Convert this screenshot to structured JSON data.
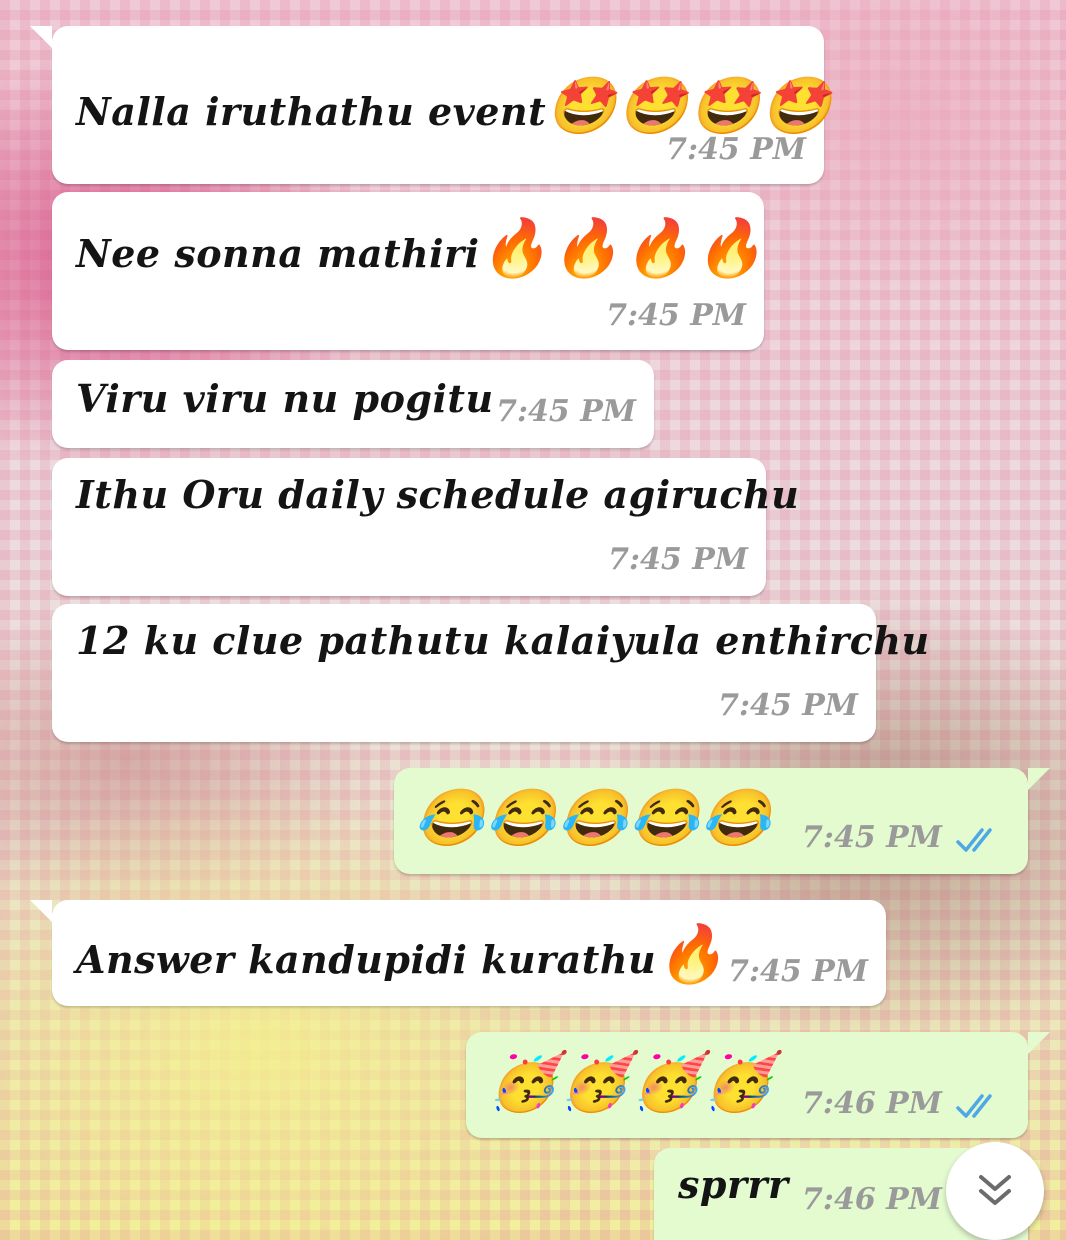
{
  "messages": [
    {
      "id": 1,
      "direction": "incoming",
      "text": "Nalla iruthathu event",
      "emoji": "🤩🤩🤩🤩",
      "time": "7:45 PM"
    },
    {
      "id": 2,
      "direction": "incoming",
      "text": "Nee sonna mathiri",
      "emoji": "🔥🔥🔥🔥",
      "time": "7:45 PM"
    },
    {
      "id": 3,
      "direction": "incoming",
      "text": "Viru viru nu pogitu",
      "time": "7:45 PM"
    },
    {
      "id": 4,
      "direction": "incoming",
      "text": "Ithu Oru daily schedule agiruchu",
      "time": "7:45 PM"
    },
    {
      "id": 5,
      "direction": "incoming",
      "text": "12 ku clue pathutu kalaiyula enthirchu",
      "time": "7:45 PM"
    },
    {
      "id": 6,
      "direction": "outgoing",
      "emoji": "😂😂😂😂😂",
      "time": "7:45 PM",
      "status": "read"
    },
    {
      "id": 7,
      "direction": "incoming",
      "text": "Answer kandupidi kurathu",
      "emoji": "🔥",
      "time": "7:45 PM"
    },
    {
      "id": 8,
      "direction": "outgoing",
      "emoji": "🥳🥳🥳🥳",
      "time": "7:46 PM",
      "status": "read"
    },
    {
      "id": 9,
      "direction": "outgoing",
      "text": "sprrr",
      "time": "7:46 PM",
      "status": "read"
    }
  ],
  "scroll_button": {
    "icon": "double-chevron-down-icon"
  },
  "colors": {
    "incoming_bubble": "#ffffff",
    "outgoing_bubble": "#e4fbd0",
    "read_ticks": "#4fa8e6",
    "timestamp": "#9a9a9a"
  }
}
